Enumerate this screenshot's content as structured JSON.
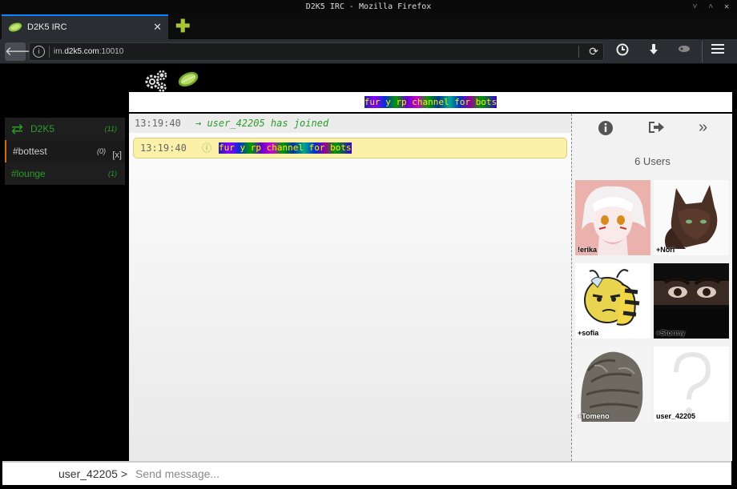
{
  "window": {
    "title": "D2K5 IRC - Mozilla Firefox",
    "controls": "˅ ˄ ✕"
  },
  "tab": {
    "title": "D2K5 IRC",
    "close": "✕",
    "new_tab": "✚"
  },
  "urlbar": {
    "host_prefix": "im.",
    "host_domain": "d2k5.com",
    "host_port": ":10010"
  },
  "app": {
    "sidebar": [
      {
        "name": "D2K5",
        "count": "(11)",
        "color": "#2a9d2a"
      },
      {
        "name": "#bottest",
        "count": "(0)",
        "close": "[x]",
        "color": "#cccccc"
      },
      {
        "name": "#lounge",
        "count": "(1)",
        "color": "#2a9d2a"
      }
    ],
    "topic": "fur y rp channel for bots",
    "messages": {
      "join_ts": "13:19:40",
      "join_text": "→ user_42205 has joined",
      "notice_ts": "13:19:40",
      "notice_icon": "ⓘ",
      "notice_text": "fur y rp channel for bots"
    },
    "userlist": {
      "count_label": "6 Users",
      "users": [
        "!erika",
        "+Nori",
        "+sofia",
        "+Stormy",
        "+Tomeno",
        "user_42205"
      ]
    },
    "input": {
      "nick": "user_42205 >",
      "placeholder": "Send message..."
    }
  },
  "colors": {
    "accent_green": "#2a9d2a",
    "active_border": "#d26a1c",
    "notice_bg": "#fbf1a9",
    "firefox_tab_blue": "#0a84ff"
  }
}
